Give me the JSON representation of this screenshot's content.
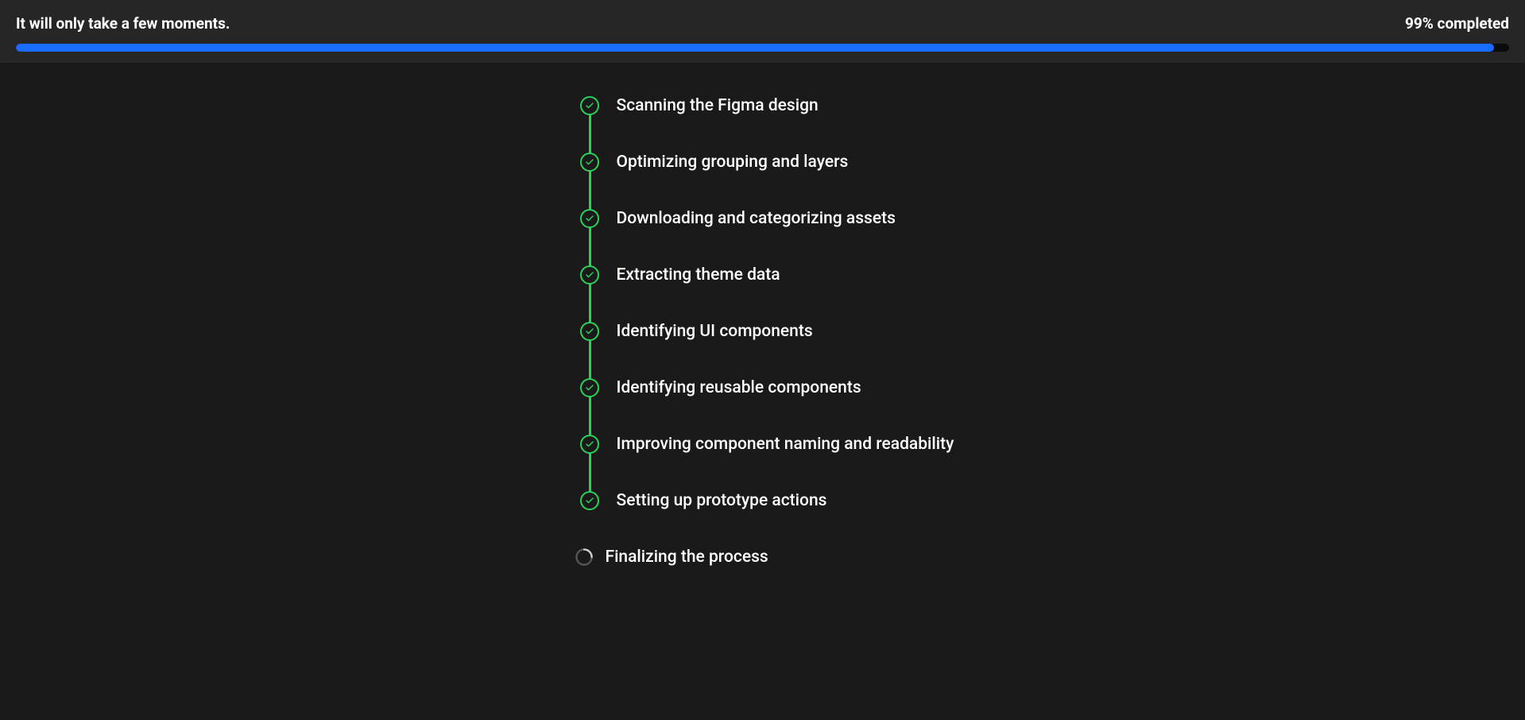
{
  "header": {
    "title": "It will only take a few moments.",
    "status": "99% completed",
    "progress_percent": 99
  },
  "steps": [
    {
      "label": "Scanning the Figma design",
      "done": true
    },
    {
      "label": "Optimizing grouping and layers",
      "done": true
    },
    {
      "label": "Downloading and categorizing assets",
      "done": true
    },
    {
      "label": "Extracting theme data",
      "done": true
    },
    {
      "label": "Identifying UI components",
      "done": true
    },
    {
      "label": "Identifying reusable components",
      "done": true
    },
    {
      "label": "Improving component naming and readability",
      "done": true
    },
    {
      "label": "Setting up prototype actions",
      "done": true
    },
    {
      "label": "Finalizing the process",
      "done": false
    }
  ],
  "colors": {
    "accent_green": "#2dcf5a",
    "accent_blue": "#1a6bff",
    "bg_dark": "#1a1a1a",
    "bg_header": "#262626"
  }
}
